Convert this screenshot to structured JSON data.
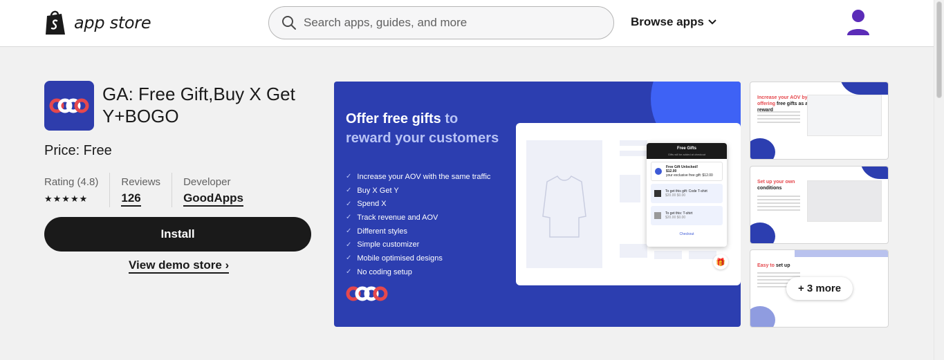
{
  "header": {
    "logo_text": "app store",
    "search_placeholder": "Search apps, guides, and more",
    "browse_label": "Browse apps"
  },
  "app": {
    "title": "GA: Free Gift,Buy X Get Y+BOGO",
    "price": "Price: Free",
    "rating_label": "Rating (4.8)",
    "rating_value": 4.8,
    "stars": "★★★★★",
    "reviews_label": "Reviews",
    "reviews_count": "126",
    "developer_label": "Developer",
    "developer_name": "GoodApps",
    "install_label": "Install",
    "demo_label": "View demo store ›"
  },
  "banner": {
    "heading_bold": "Offer free gifts",
    "heading_accent": " to reward your customers",
    "features": [
      "Increase your AOV with the same traffic",
      "Buy X Get Y",
      "Spend X",
      "Track revenue and AOV",
      "Different styles",
      "Simple customizer",
      "Mobile optimised designs",
      "No coding setup"
    ],
    "popup": {
      "title": "Free Gifts",
      "subtitle": "Gifts will be added at checkout",
      "item1_title": "Free Gift Unlocked!",
      "item1_price": "$12.00",
      "item1_desc": "your exclusive free gift: $12.00",
      "item2": "To get this gift: Code T-shirt",
      "item2_price": "$20.00 $0.00",
      "item3": "To get this: T-shirt",
      "item3_price": "$20.00 $0.00",
      "checkout": "Checkout"
    }
  },
  "thumbnails": [
    {
      "title_red": "Increase your AOV by offering",
      "title_dark": " free gifts as a reward"
    },
    {
      "title_red": "Set up your own",
      "title_dark": " conditions"
    },
    {
      "title_red": "Easy to",
      "title_dark": " set up"
    }
  ],
  "more_label": "+ 3 more",
  "colors": {
    "brand_blue": "#2c3eb0",
    "accent_blue": "#3e62f5",
    "accent_red": "#e5484d",
    "button_dark": "#1a1a1a"
  }
}
